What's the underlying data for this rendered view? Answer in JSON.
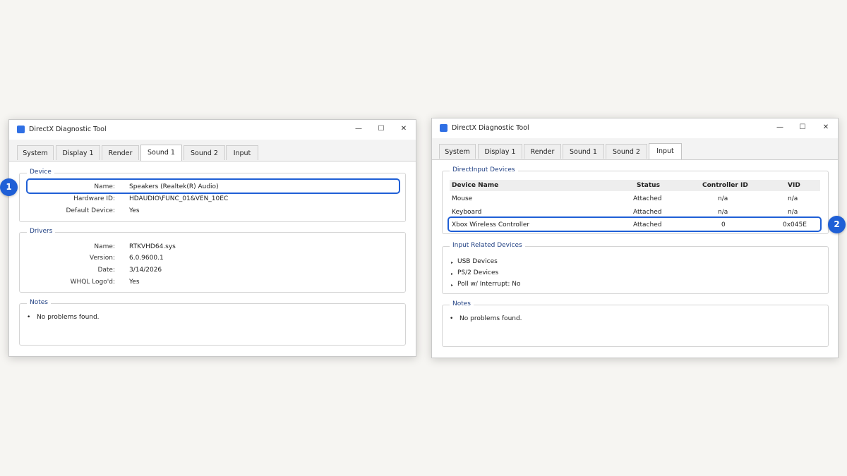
{
  "window1": {
    "title": "DirectX Diagnostic Tool",
    "controls": {
      "minimize": "—",
      "maximize": "☐",
      "close": "✕"
    },
    "tabs": [
      "System",
      "Display 1",
      "Render",
      "Sound 1",
      "Sound 2",
      "Input"
    ],
    "active_tab": "Sound 1",
    "device": {
      "group_label": "Device",
      "rows": [
        {
          "label": "Name:",
          "value": "Speakers (Realtek(R) Audio)"
        },
        {
          "label": "Hardware ID:",
          "value": "HDAUDIO\\FUNC_01&VEN_10EC"
        },
        {
          "label": "Default Device:",
          "value": "Yes"
        }
      ]
    },
    "drivers": {
      "group_label": "Drivers",
      "rows": [
        {
          "label": "Name:",
          "value": "RTKVHD64.sys"
        },
        {
          "label": "Version:",
          "value": "6.0.9600.1"
        },
        {
          "label": "Date:",
          "value": "3/14/2026"
        },
        {
          "label": "WHQL Logo'd:",
          "value": "Yes"
        }
      ]
    },
    "notes": {
      "group_label": "Notes",
      "bullet": "•",
      "items": [
        "No problems found."
      ]
    }
  },
  "window2": {
    "title": "DirectX Diagnostic Tool",
    "controls": {
      "minimize": "—",
      "maximize": "☐",
      "close": "✕"
    },
    "tabs": [
      "System",
      "Display 1",
      "Render",
      "Sound 1",
      "Sound 2",
      "Input"
    ],
    "active_tab": "Input",
    "directinput": {
      "group_label": "DirectInput Devices",
      "columns": [
        "Device Name",
        "Status",
        "Controller ID",
        "VID"
      ],
      "rows": [
        [
          "Mouse",
          "Attached",
          "n/a",
          "n/a"
        ],
        [
          "Keyboard",
          "Attached",
          "n/a",
          "n/a"
        ],
        [
          "Xbox Wireless Controller",
          "Attached",
          "0",
          "0x045E"
        ]
      ]
    },
    "input_related": {
      "group_label": "Input Related Devices",
      "arrow": "▸",
      "items": [
        "USB Devices",
        "PS/2 Devices",
        "Poll w/ Interrupt: No"
      ]
    },
    "notes": {
      "group_label": "Notes",
      "bullet": "•",
      "items": [
        "No problems found."
      ]
    }
  },
  "annotations": {
    "badge1": "1",
    "badge2": "2"
  },
  "colors": {
    "highlight": "#1f5fd6",
    "group_label": "#1f3f82",
    "app_icon": "#2f6fe4"
  }
}
